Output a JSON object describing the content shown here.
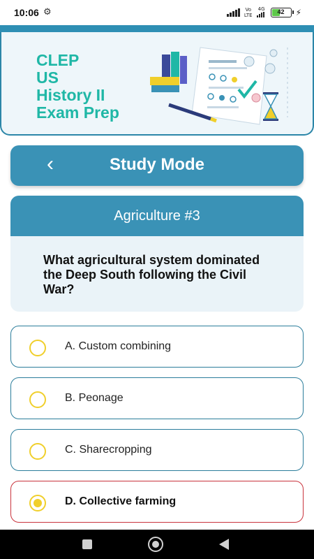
{
  "status": {
    "time": "10:06",
    "settings_icon": "gear-icon",
    "network_tag_top": "Vo",
    "network_tag_bottom": "LTE",
    "network_type": "4G",
    "battery_level": "42",
    "charging_icon": "bolt-icon"
  },
  "header": {
    "title_lines": [
      "CLEP",
      "US",
      "History II",
      "Exam Prep"
    ],
    "illustration": "exam-illustration"
  },
  "nav": {
    "back_icon": "chevron-left-icon",
    "title": "Study Mode"
  },
  "question": {
    "topic": "Agriculture #3",
    "text": "What agricultural system dominated the Deep South following the Civil War?"
  },
  "options": [
    {
      "label": "A. Custom combining",
      "selected": false
    },
    {
      "label": "B. Peonage",
      "selected": false
    },
    {
      "label": "C. Sharecropping",
      "selected": false
    },
    {
      "label": "D. Collective farming",
      "selected": true
    }
  ],
  "colors": {
    "primary": "#3a92b6",
    "title_teal": "#1fb7a6",
    "radio_yellow": "#f0cf2b",
    "selected_border": "#c9333c",
    "option_border": "#2b7d9b"
  },
  "system_nav": [
    "recent-apps-icon",
    "home-icon",
    "back-icon"
  ]
}
